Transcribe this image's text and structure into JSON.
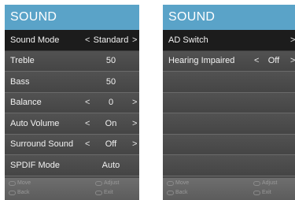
{
  "left_panel": {
    "title": "SOUND",
    "rows": [
      {
        "label": "Sound Mode",
        "arrow_left": "<",
        "value": "Standard",
        "arrow_right": ">"
      },
      {
        "label": "Treble",
        "arrow_left": "",
        "value": "50",
        "arrow_right": ""
      },
      {
        "label": "Bass",
        "arrow_left": "",
        "value": "50",
        "arrow_right": ""
      },
      {
        "label": "Balance",
        "arrow_left": "<",
        "value": "0",
        "arrow_right": ">"
      },
      {
        "label": "Auto Volume",
        "arrow_left": "<",
        "value": "On",
        "arrow_right": ">"
      },
      {
        "label": "Surround Sound",
        "arrow_left": "<",
        "value": "Off",
        "arrow_right": ">"
      },
      {
        "label": "SPDIF Mode",
        "arrow_left": "",
        "value": "Auto",
        "arrow_right": ""
      }
    ],
    "footer": {
      "move": "Move",
      "adjust": "Adjust",
      "back": "Back",
      "exit": "Exit"
    }
  },
  "right_panel": {
    "title": "SOUND",
    "rows": [
      {
        "label": "AD Switch",
        "arrow_left": "",
        "value": "",
        "arrow_right": ">"
      },
      {
        "label": "Hearing Impaired",
        "arrow_left": "<",
        "value": "Off",
        "arrow_right": ">"
      },
      {
        "label": "",
        "arrow_left": "",
        "value": "",
        "arrow_right": ""
      },
      {
        "label": "",
        "arrow_left": "",
        "value": "",
        "arrow_right": ""
      },
      {
        "label": "",
        "arrow_left": "",
        "value": "",
        "arrow_right": ""
      },
      {
        "label": "",
        "arrow_left": "",
        "value": "",
        "arrow_right": ""
      },
      {
        "label": "",
        "arrow_left": "",
        "value": "",
        "arrow_right": ""
      }
    ],
    "footer": {
      "move": "Move",
      "adjust": "Adjust",
      "back": "Back",
      "exit": "Exit"
    }
  },
  "colors": {
    "header": "#5aa3c8",
    "panel": "#4a4a4a",
    "selected_row": "#1c1c1c"
  },
  "icons": {
    "move": "dpad-icon",
    "adjust": "ok-icon",
    "back": "back-icon",
    "exit": "exit-icon"
  }
}
